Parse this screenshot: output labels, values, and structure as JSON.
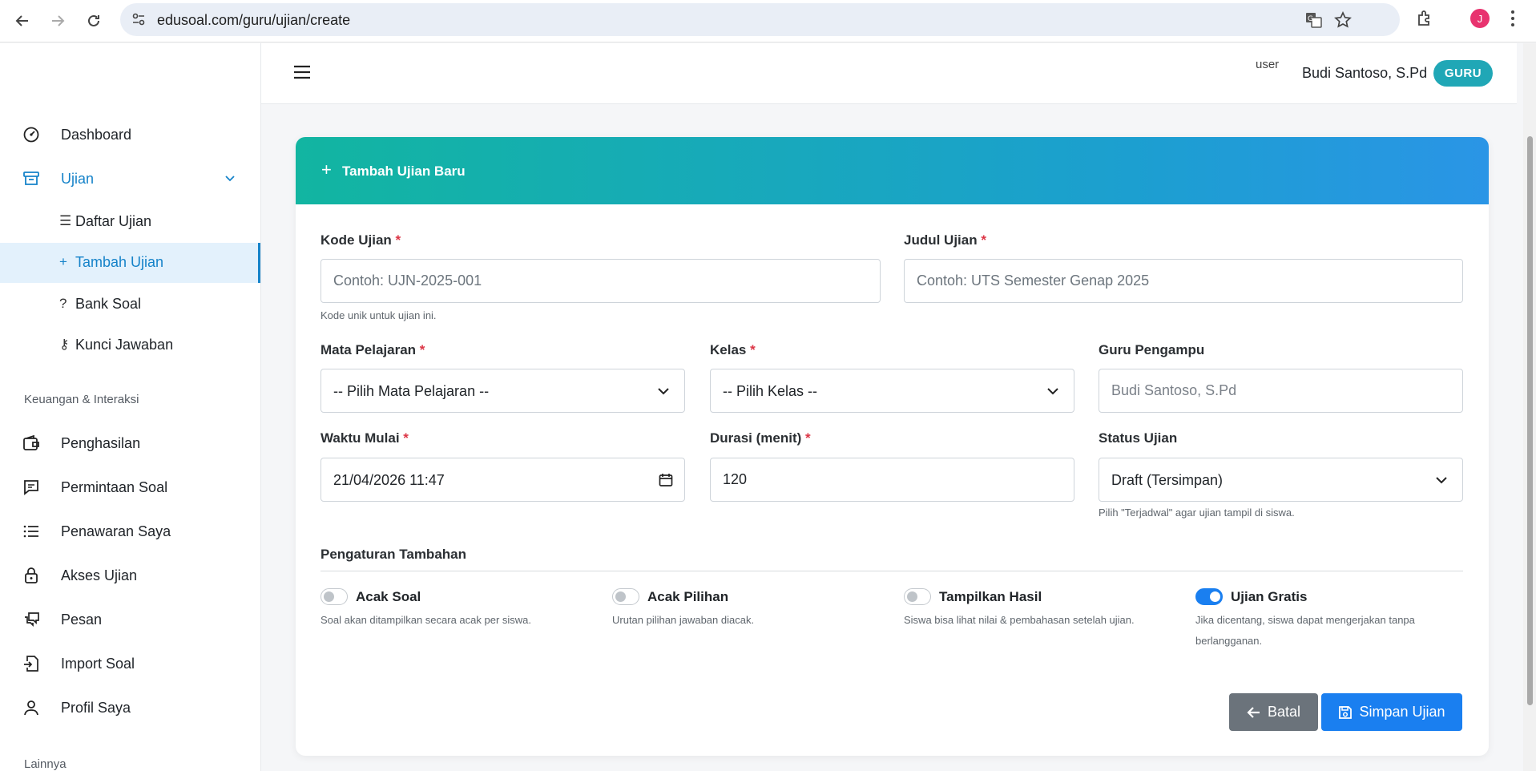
{
  "browser": {
    "url": "edusoal.com/guru/ujian/create",
    "profile_initial": "J"
  },
  "sidebar": {
    "items": [
      {
        "label": "Dashboard",
        "icon": "dashboard-icon"
      },
      {
        "label": "Ujian",
        "icon": "archive-icon"
      }
    ],
    "sub_items": [
      {
        "glyph": "☰",
        "label": "Daftar Ujian"
      },
      {
        "glyph": "+",
        "label": "Tambah Ujian"
      },
      {
        "glyph": "?",
        "label": "Bank Soal"
      },
      {
        "glyph": "⚷",
        "label": "Kunci Jawaban"
      }
    ],
    "section_finance": "Keuangan & Interaksi",
    "finance_items": [
      {
        "label": "Penghasilan",
        "icon": "wallet-icon"
      },
      {
        "label": "Permintaan Soal",
        "icon": "chat-icon"
      },
      {
        "label": "Penawaran Saya",
        "icon": "list-icon"
      },
      {
        "label": "Akses Ujian",
        "icon": "lock-icon"
      },
      {
        "label": "Pesan",
        "icon": "messages-icon"
      },
      {
        "label": "Import Soal",
        "icon": "file-import-icon"
      },
      {
        "label": "Profil Saya",
        "icon": "person-icon"
      }
    ],
    "section_other": "Lainnya"
  },
  "topbar": {
    "avatar_alt": "user",
    "user_name": "Budi Santoso, S.Pd",
    "role": "GURU"
  },
  "form": {
    "header_title": "Tambah Ujian Baru",
    "kode_label": "Kode Ujian",
    "kode_placeholder": "Contoh: UJN-2025-001",
    "kode_help": "Kode unik untuk ujian ini.",
    "judul_label": "Judul Ujian",
    "judul_placeholder": "Contoh: UTS Semester Genap 2025",
    "mapel_label": "Mata Pelajaran",
    "mapel_value": "-- Pilih Mata Pelajaran --",
    "kelas_label": "Kelas",
    "kelas_value": "-- Pilih Kelas --",
    "guru_label": "Guru Pengampu",
    "guru_value": "Budi Santoso, S.Pd",
    "waktu_label": "Waktu Mulai",
    "waktu_value": "21/04/2026 11:47",
    "durasi_label": "Durasi (menit)",
    "durasi_value": "120",
    "status_label": "Status Ujian",
    "status_value": "Draft (Tersimpan)",
    "status_help": "Pilih \"Terjadwal\" agar ujian tampil di siswa.",
    "required_mark": "*",
    "section_title": "Pengaturan Tambahan",
    "toggles": [
      {
        "label": "Acak Soal",
        "help": "Soal akan ditampilkan secara acak per siswa.",
        "on": false
      },
      {
        "label": "Acak Pilihan",
        "help": "Urutan pilihan jawaban diacak.",
        "on": false
      },
      {
        "label": "Tampilkan Hasil",
        "help": "Siswa bisa lihat nilai & pembahasan setelah ujian.",
        "on": false
      },
      {
        "label": "Ujian Gratis",
        "help": "Jika dicentang, siswa dapat mengerjakan tanpa berlangganan.",
        "on": true
      }
    ],
    "cancel_label": "Batal",
    "save_label": "Simpan Ujian"
  },
  "colors": {
    "primary": "#1a7ff0",
    "accent": "#1683c9",
    "header_gradient_start": "#12b5a1",
    "header_gradient_end": "#2a95e6",
    "badge": "#20a7b6",
    "danger": "#dc3545"
  }
}
